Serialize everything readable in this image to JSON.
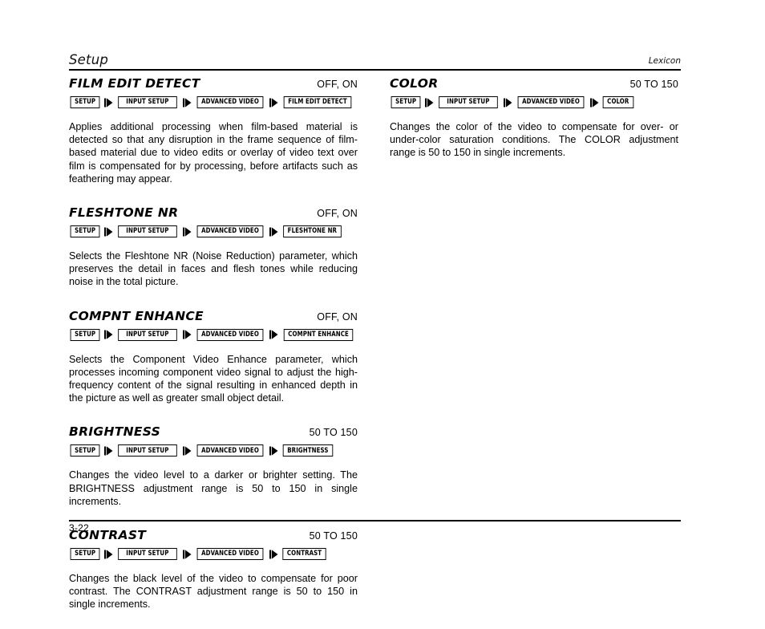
{
  "header": {
    "title": "Setup",
    "brand": "Lexicon"
  },
  "footer": {
    "page_number": "3-22"
  },
  "crumb_arrow_icon": "triangle-right-icon",
  "left_column": [
    {
      "title": "FILM EDIT DETECT",
      "value": "OFF, ON",
      "crumbs": [
        "SETUP",
        "INPUT SETUP",
        "ADVANCED VIDEO",
        "FILM EDIT DETECT"
      ],
      "body": "Applies additional processing when film-based material is detected so that any disruption in the frame sequence of film-based material due to video edits or overlay of video text over film is compensated for by processing, before artifacts such as feathering may appear."
    },
    {
      "title": "FLESHTONE NR",
      "value": "OFF, ON",
      "crumbs": [
        "SETUP",
        "INPUT SETUP",
        "ADVANCED VIDEO",
        "FLESHTONE NR"
      ],
      "body": "Selects the Fleshtone NR (Noise Reduction) parameter, which preserves the detail in faces and flesh tones while reducing noise in the total picture."
    },
    {
      "title": "COMPNT ENHANCE",
      "value": "OFF, ON",
      "crumbs": [
        "SETUP",
        "INPUT SETUP",
        "ADVANCED VIDEO",
        "COMPNT ENHANCE"
      ],
      "body": "Selects the Component Video Enhance parameter, which processes incoming component video signal to adjust the high-frequency content of the signal resulting in enhanced depth in the picture as well as greater small object detail."
    },
    {
      "title": "BRIGHTNESS",
      "value": "50 TO 150",
      "crumbs": [
        "SETUP",
        "INPUT SETUP",
        "ADVANCED VIDEO",
        "BRIGHTNESS"
      ],
      "body": "Changes the video level to a darker or brighter setting. The BRIGHTNESS adjustment range is 50 to 150 in single increments."
    },
    {
      "title": "CONTRAST",
      "value": "50 TO 150",
      "crumbs": [
        "SETUP",
        "INPUT SETUP",
        "ADVANCED VIDEO",
        "CONTRAST"
      ],
      "body": "Changes the black level of the video to compensate for poor contrast. The CONTRAST adjustment range is 50 to 150 in single increments."
    }
  ],
  "right_column": [
    {
      "title": "COLOR",
      "value": "50 TO 150",
      "crumbs": [
        "SETUP",
        "INPUT SETUP",
        "ADVANCED VIDEO",
        "COLOR"
      ],
      "body": "Changes the color of the video to compensate for over- or under-color saturation conditions. The COLOR adjustment range is 50 to 150 in single increments."
    }
  ]
}
